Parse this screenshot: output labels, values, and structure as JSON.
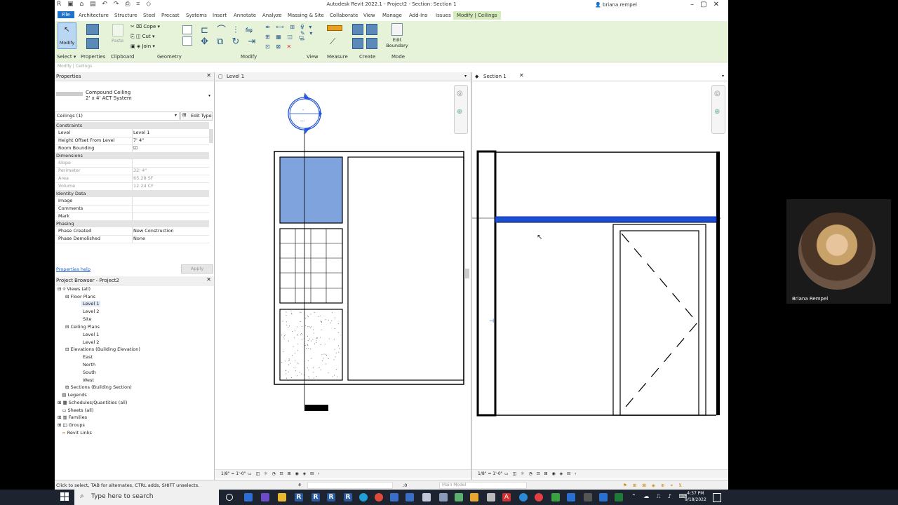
{
  "app": {
    "title": "Autodesk Revit 2022.1 - Project2 - Section: Section 1",
    "user": "briana.rempel"
  },
  "tabs": [
    "File",
    "Architecture",
    "Structure",
    "Steel",
    "Precast",
    "Systems",
    "Insert",
    "Annotate",
    "Analyze",
    "Massing & Site",
    "Collaborate",
    "View",
    "Manage",
    "Add-Ins",
    "Issues",
    "Modify | Ceilings"
  ],
  "ribbon": {
    "modify_label": "Modify",
    "cope": "Cope",
    "cut": "Cut",
    "join": "Join",
    "paste": "Paste",
    "edit_boundary": "Edit Boundary",
    "groups": [
      "Select",
      "Properties",
      "Clipboard",
      "Geometry",
      "Modify",
      "View",
      "Measure",
      "Create",
      "Mode"
    ]
  },
  "context_bar": "Modify | Ceilings",
  "properties": {
    "header": "Properties",
    "type_name": "Compound Ceiling",
    "type_sub": "2' x 4' ACT System",
    "selector": "Ceilings (1)",
    "edit_type": "Edit Type",
    "sections": {
      "constraints": "Constraints",
      "dimensions": "Dimensions",
      "identity": "Identity Data",
      "phasing": "Phasing"
    },
    "rows": {
      "level": {
        "k": "Level",
        "v": "Level 1"
      },
      "height_offset": {
        "k": "Height Offset From Level",
        "v": "7'  4\""
      },
      "room_bounding": {
        "k": "Room Bounding",
        "v": "☑"
      },
      "slope": {
        "k": "Slope",
        "v": ""
      },
      "perimeter": {
        "k": "Perimeter",
        "v": "32'  4\""
      },
      "area": {
        "k": "Area",
        "v": "65.28 SF"
      },
      "volume": {
        "k": "Volume",
        "v": "12.24 CF"
      },
      "image": {
        "k": "Image",
        "v": ""
      },
      "comments": {
        "k": "Comments",
        "v": ""
      },
      "mark": {
        "k": "Mark",
        "v": ""
      },
      "phase_created": {
        "k": "Phase Created",
        "v": "New Construction"
      },
      "phase_demolished": {
        "k": "Phase Demolished",
        "v": "None"
      }
    },
    "help_link": "Properties help",
    "apply": "Apply"
  },
  "browser": {
    "header": "Project Browser - Project2",
    "items": {
      "views": "Views (all)",
      "floor_plans": "Floor Plans",
      "fp_level1": "Level 1",
      "fp_level2": "Level 2",
      "fp_site": "Site",
      "ceiling_plans": "Ceiling Plans",
      "cp_level1": "Level 1",
      "cp_level2": "Level 2",
      "elevations": "Elevations (Building Elevation)",
      "east": "East",
      "north": "North",
      "south": "South",
      "west": "West",
      "sections": "Sections (Building Section)",
      "legends": "Legends",
      "schedules": "Schedules/Quantities (all)",
      "sheets": "Sheets (all)",
      "families": "Families",
      "groups": "Groups",
      "revit_links": "Revit Links"
    }
  },
  "views": {
    "left_tab": "Level 1",
    "right_tab": "Section 1",
    "scale_left": "1/8\" = 1'-0\"",
    "scale_right": "1/8\" = 1'-0\""
  },
  "status": {
    "hint": "Click to select, TAB for alternates, CTRL adds, SHIFT unselects.",
    "count": ":0",
    "model": "Main Model"
  },
  "taskbar": {
    "search": "Type here to search",
    "time": "4:37 PM",
    "date": "9/18/2022"
  },
  "webcam": {
    "name": "Briana Rempel"
  },
  "colors": {
    "accent": "#1e73c8",
    "ribbon_bg": "#e7f3d9",
    "selected_ceiling": "#1a4fd6",
    "fill_blue": "#7fa3dd"
  }
}
